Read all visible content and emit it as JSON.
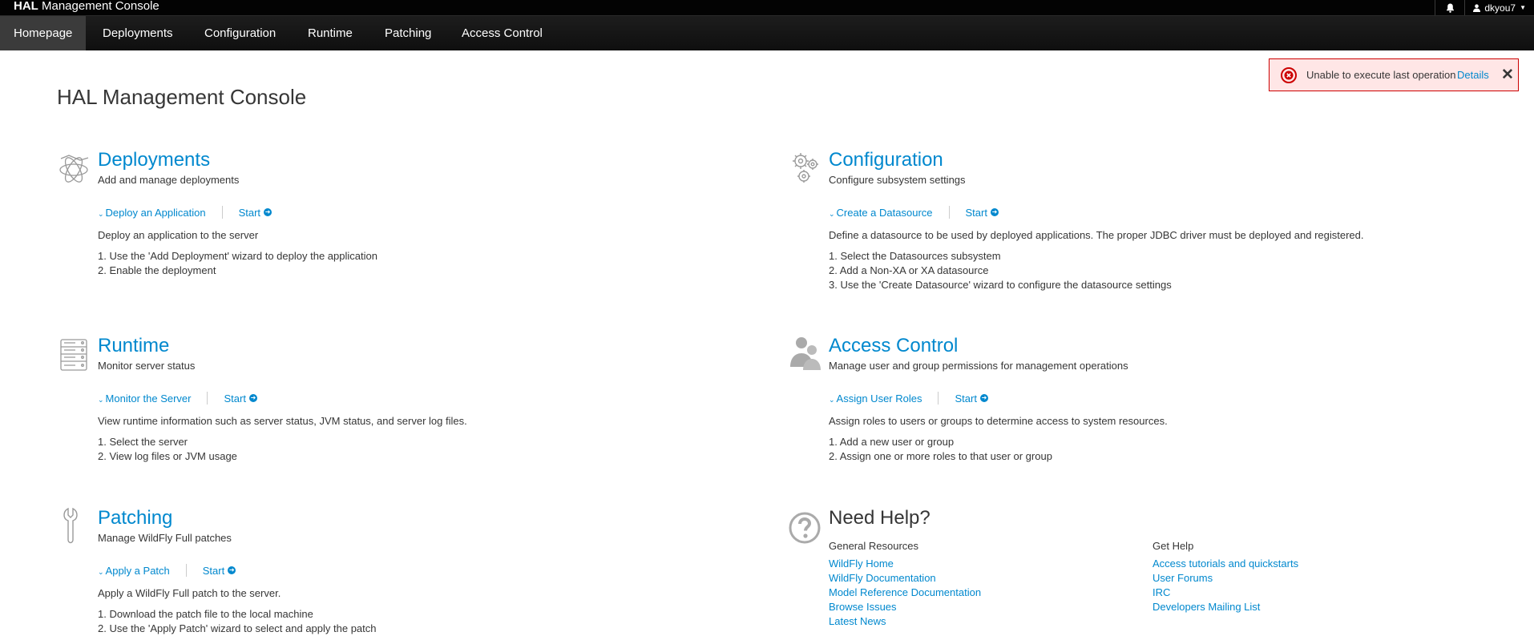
{
  "app": {
    "brand_bold": "HAL",
    "brand_rest": " Management Console",
    "user": "dkyou7"
  },
  "nav": [
    {
      "label": "Homepage"
    },
    {
      "label": "Deployments"
    },
    {
      "label": "Configuration"
    },
    {
      "label": "Runtime"
    },
    {
      "label": "Patching"
    },
    {
      "label": "Access Control"
    }
  ],
  "page_title": "HAL Management Console",
  "toast": {
    "message": "Unable to execute last operation",
    "details_label": "Details",
    "close": "✕"
  },
  "sections": {
    "deployments": {
      "title": "Deployments",
      "subtitle": "Add and manage deployments",
      "action": "Deploy an Application",
      "start": "Start",
      "description": "Deploy an application to the server",
      "steps": [
        "1. Use the 'Add Deployment' wizard to deploy the application",
        "2. Enable the deployment"
      ]
    },
    "configuration": {
      "title": "Configuration",
      "subtitle": "Configure subsystem settings",
      "action": "Create a Datasource",
      "start": "Start",
      "description": "Define a datasource to be used by deployed applications. The proper JDBC driver must be deployed and registered.",
      "steps": [
        "1. Select the Datasources subsystem",
        "2. Add a Non-XA or XA datasource",
        "3. Use the 'Create Datasource' wizard to configure the datasource settings"
      ]
    },
    "runtime": {
      "title": "Runtime",
      "subtitle": "Monitor server status",
      "action": "Monitor the Server",
      "start": "Start",
      "description": "View runtime information such as server status, JVM status, and server log files.",
      "steps": [
        "1. Select the server",
        "2. View log files or JVM usage"
      ]
    },
    "access_control": {
      "title": "Access Control",
      "subtitle": "Manage user and group permissions for management operations",
      "action": "Assign User Roles",
      "start": "Start",
      "description": "Assign roles to users or groups to determine access to system resources.",
      "steps": [
        "1. Add a new user or group",
        "2. Assign one or more roles to that user or group"
      ]
    },
    "patching": {
      "title": "Patching",
      "subtitle": "Manage WildFly Full patches",
      "action": "Apply a Patch",
      "start": "Start",
      "description": "Apply a WildFly Full patch to the server.",
      "steps": [
        "1. Download the patch file to the local machine",
        "2. Use the 'Apply Patch' wizard to select and apply the patch"
      ]
    }
  },
  "help": {
    "title": "Need Help?",
    "general": {
      "heading": "General Resources",
      "links": [
        "WildFly Home",
        "WildFly Documentation",
        "Model Reference Documentation",
        "Browse Issues",
        "Latest News"
      ]
    },
    "get_help": {
      "heading": "Get Help",
      "links": [
        "Access tutorials and quickstarts",
        "User Forums",
        "IRC",
        "Developers Mailing List"
      ]
    }
  },
  "icons": {
    "bell": "bell-icon",
    "user": "user-icon",
    "error": "error-circle-icon",
    "deployments": "deployments-icon",
    "configuration": "gears-icon",
    "runtime": "server-rack-icon",
    "access_control": "users-icon",
    "patching": "wrench-icon",
    "help": "question-circle-icon"
  },
  "colors": {
    "link": "#0088ce",
    "toast_bg": "#ffe6e6",
    "toast_border": "#cc0000",
    "nav_bg": "#1d1d1d"
  }
}
